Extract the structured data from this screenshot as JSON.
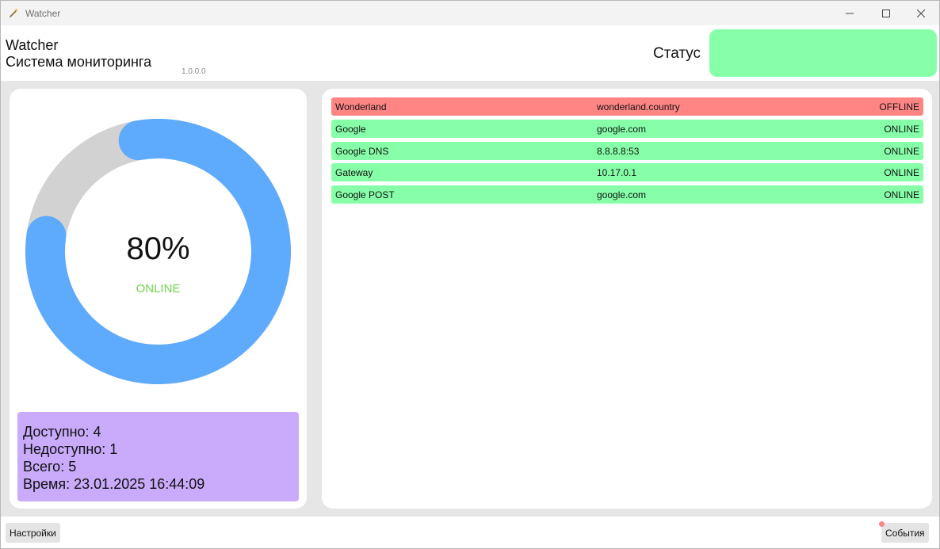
{
  "window": {
    "title": "Watcher",
    "icons": {
      "app": "wand-icon",
      "minimize": "minimize-icon",
      "maximize": "maximize-icon",
      "close": "close-icon"
    }
  },
  "header": {
    "app_name": "Watcher",
    "subtitle": "Система мониторинга",
    "version": "1.0.0.0",
    "status_label": "Статус",
    "status_color": "#86ffa8"
  },
  "chart_data": {
    "type": "donut",
    "value": 80,
    "max": 100,
    "center_label": "80%",
    "status_text": "ONLINE",
    "colors": {
      "fill": "#5eaafd",
      "track": "#d2d2d2",
      "status": "#6fd44e"
    }
  },
  "stats": {
    "available": "Доступно: 4",
    "unavailable": "Недоступно: 1",
    "total": "Всего: 5",
    "time": "Время: 23.01.2025 16:44:09"
  },
  "services": [
    {
      "name": "Wonderland",
      "address": "wonderland.country",
      "state": "OFFLINE",
      "color": "#ff8585"
    },
    {
      "name": "Google",
      "address": "google.com",
      "state": "ONLINE",
      "color": "#86ffa8"
    },
    {
      "name": "Google DNS",
      "address": "8.8.8.8:53",
      "state": "ONLINE",
      "color": "#86ffa8"
    },
    {
      "name": "Gateway",
      "address": "10.17.0.1",
      "state": "ONLINE",
      "color": "#86ffa8"
    },
    {
      "name": "Google POST",
      "address": "google.com",
      "state": "ONLINE",
      "color": "#86ffa8"
    }
  ],
  "footer": {
    "settings_label": "Настройки",
    "events_label": "События",
    "events_dot_color": "#ff8585"
  }
}
